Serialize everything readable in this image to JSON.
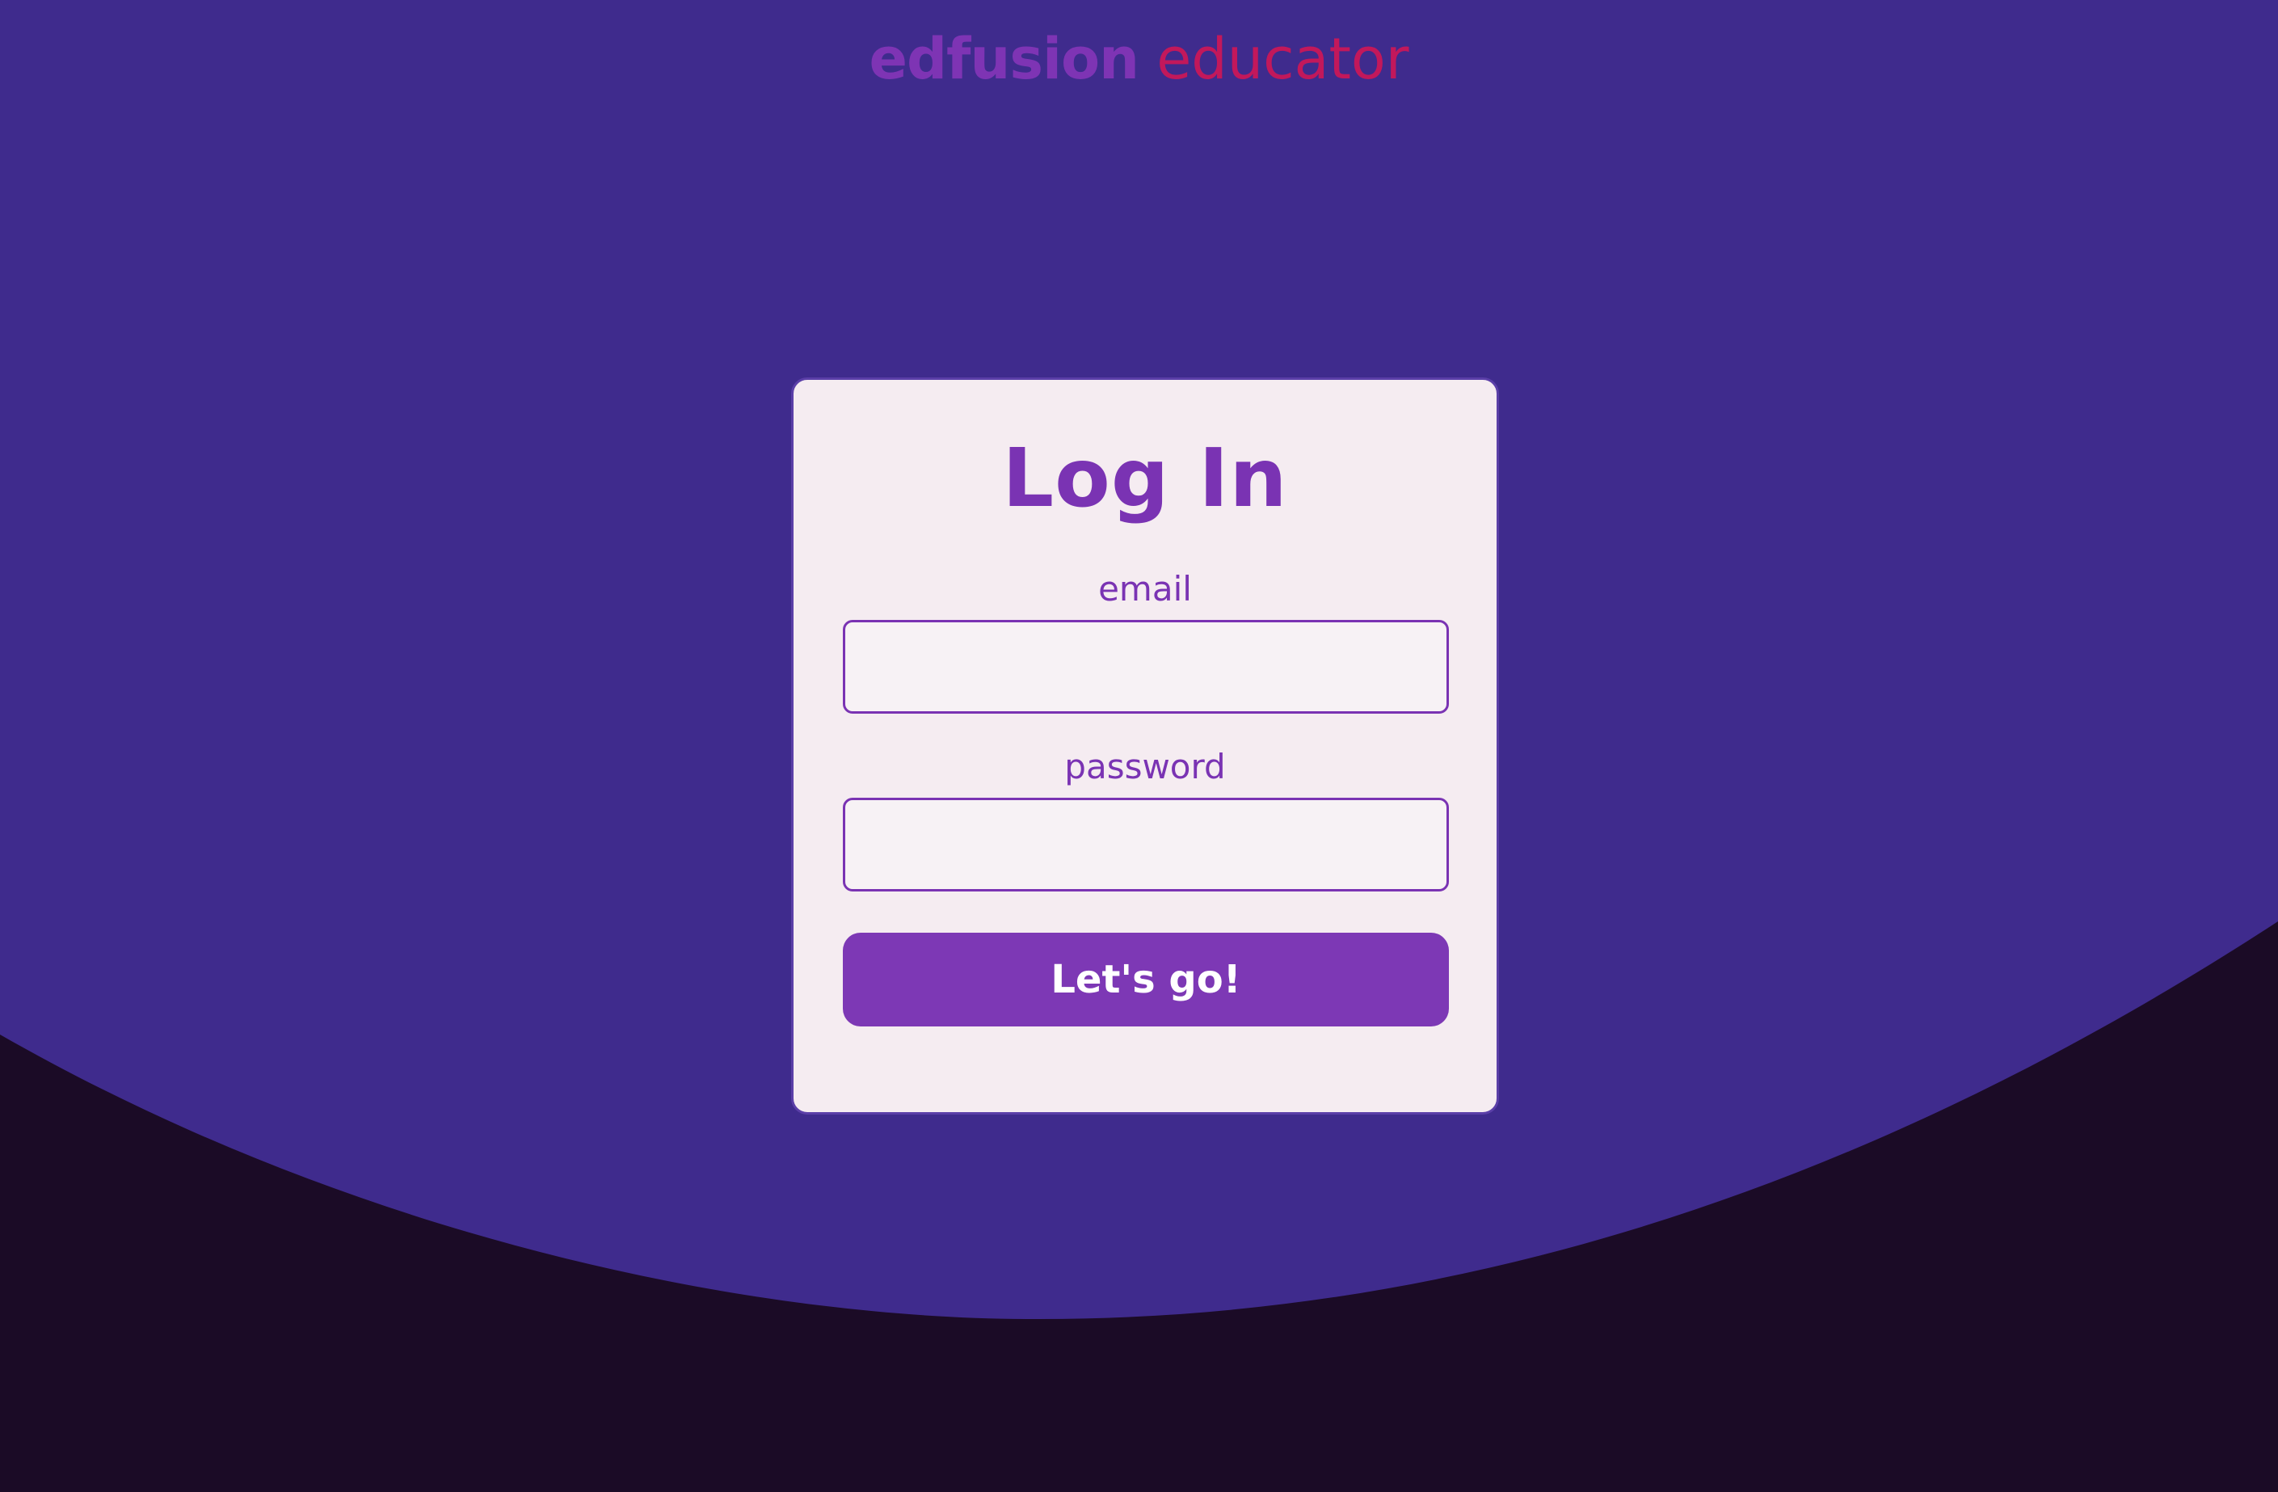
{
  "brand": {
    "part1": "edfusion",
    "part2": "educator",
    "color1": "#7e34b4",
    "color2": "#c2185b"
  },
  "login": {
    "title": "Log In",
    "email_label": "email",
    "email_value": "",
    "password_label": "password",
    "password_value": "",
    "submit_label": "Let's go!"
  },
  "colors": {
    "background": "#3f2b8d",
    "wave": "#1b0b26",
    "card": "#f5ecf1",
    "accent": "#7d38b5"
  }
}
